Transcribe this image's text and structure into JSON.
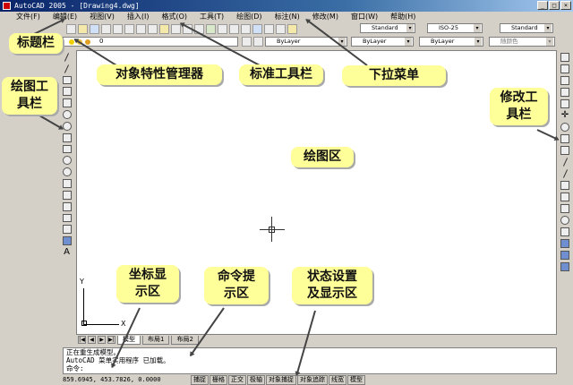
{
  "window": {
    "title": "AutoCAD 2005 - [Drawing4.dwg]",
    "controls": [
      "_",
      "□",
      "×"
    ]
  },
  "menu": [
    "文件(F)",
    "编辑(E)",
    "视图(V)",
    "插入(I)",
    "格式(O)",
    "工具(T)",
    "绘图(D)",
    "标注(N)",
    "修改(M)",
    "窗口(W)",
    "帮助(H)"
  ],
  "toolbar": {
    "text_style": "Standard",
    "dim_style": "ISO-25",
    "table_style": "Standard",
    "layer_current": "0",
    "color": "ByLayer",
    "linetype": "ByLayer",
    "lineweight": "ByLayer",
    "plot_style": "随颜色"
  },
  "canvas": {
    "ucs_y": "Y",
    "ucs_x": "X"
  },
  "tabs": {
    "nav": [
      "|◀",
      "◀",
      "▶",
      "▶|"
    ],
    "items": [
      "模型",
      "布局1",
      "布局2"
    ]
  },
  "command": {
    "lines": [
      "正在重生成模型。",
      "AutoCAD 菜单实用程序 已加载。",
      "命令:"
    ]
  },
  "status": {
    "coords": "859.6945,  453.7826, 0.0000",
    "modes": [
      "捕捉",
      "栅格",
      "正交",
      "极轴",
      "对象捕捉",
      "对象追踪",
      "线宽",
      "模型"
    ]
  },
  "callouts": {
    "title_bar": "标题栏",
    "object_props": "对象特性管理器",
    "std_toolbar": "标准工具栏",
    "dropdown_menu": "下拉菜单",
    "draw_toolbar": "绘图工\n具栏",
    "modify_toolbar": "修改工\n具栏",
    "drawing_area": "绘图区",
    "coord_display": "坐标显\n示区",
    "command_area": "命令提\n示区",
    "status_area": "状态设置\n及显示区"
  }
}
